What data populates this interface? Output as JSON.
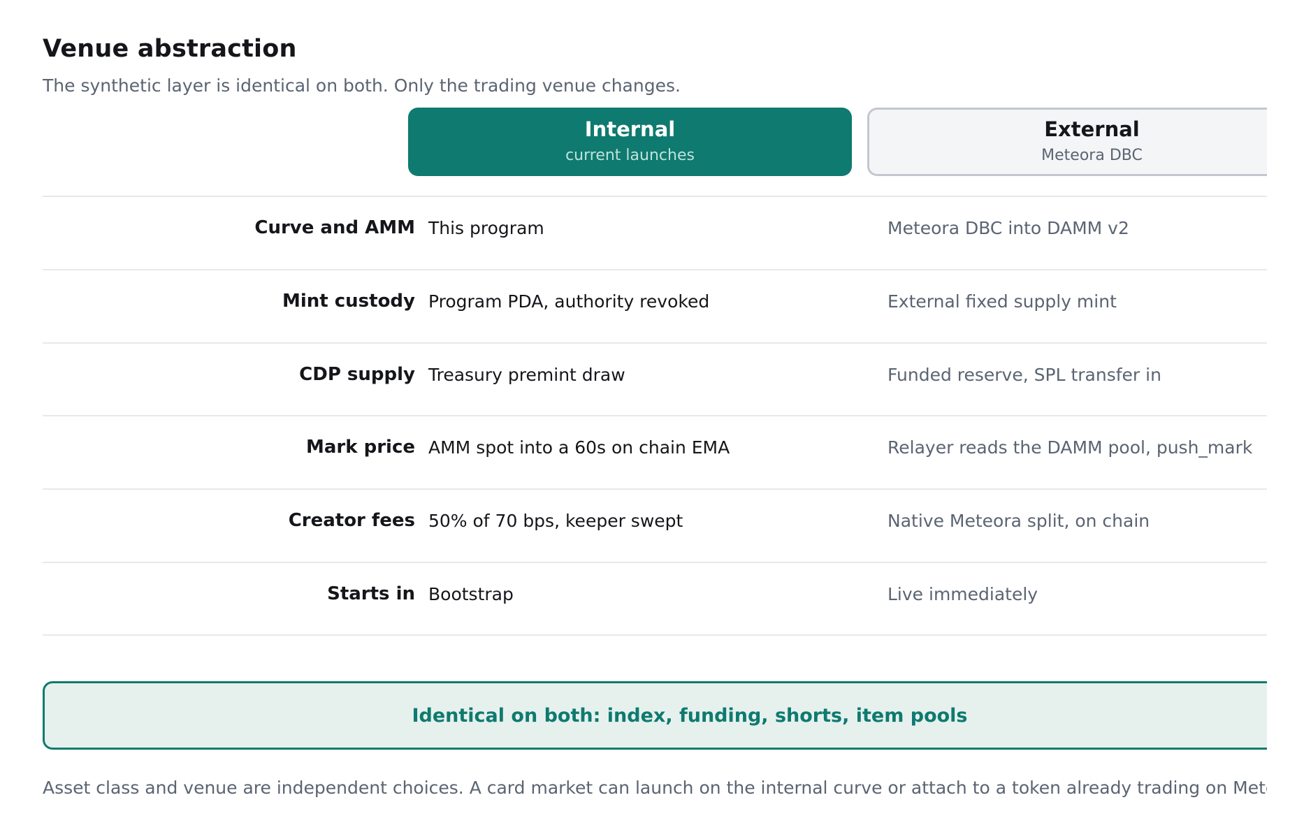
{
  "header": {
    "title": "Venue abstraction",
    "subtitle": "The synthetic layer is identical on both. Only the trading venue changes."
  },
  "venues": {
    "internal": {
      "name": "Internal",
      "subtitle": "current launches"
    },
    "external": {
      "name": "External",
      "subtitle": "Meteora DBC"
    }
  },
  "rows": [
    {
      "label": "Curve and AMM",
      "internal": "This program",
      "external": "Meteora DBC into DAMM v2"
    },
    {
      "label": "Mint custody",
      "internal": "Program PDA, authority revoked",
      "external": "External fixed supply mint"
    },
    {
      "label": "CDP supply",
      "internal": "Treasury premint draw",
      "external": "Funded reserve, SPL transfer in"
    },
    {
      "label": "Mark price",
      "internal": "AMM spot into a 60s on chain EMA",
      "external": "Relayer reads the DAMM pool, push_mark"
    },
    {
      "label": "Creator fees",
      "internal": "50% of 70 bps, keeper swept",
      "external": "Native Meteora split, on chain"
    },
    {
      "label": "Starts in",
      "internal": "Bootstrap",
      "external": "Live immediately"
    }
  ],
  "banner": {
    "text": "Identical on both: index, funding, shorts, item pools"
  },
  "footnote": "Asset class and venue are independent choices. A card market can launch on the internal curve or attach to a token already trading on Meteora.",
  "colors": {
    "accent": "#0f7a6f",
    "accent_light": "#e6f1ee",
    "muted_text": "#5b6472",
    "divider": "#e6e8eb"
  }
}
